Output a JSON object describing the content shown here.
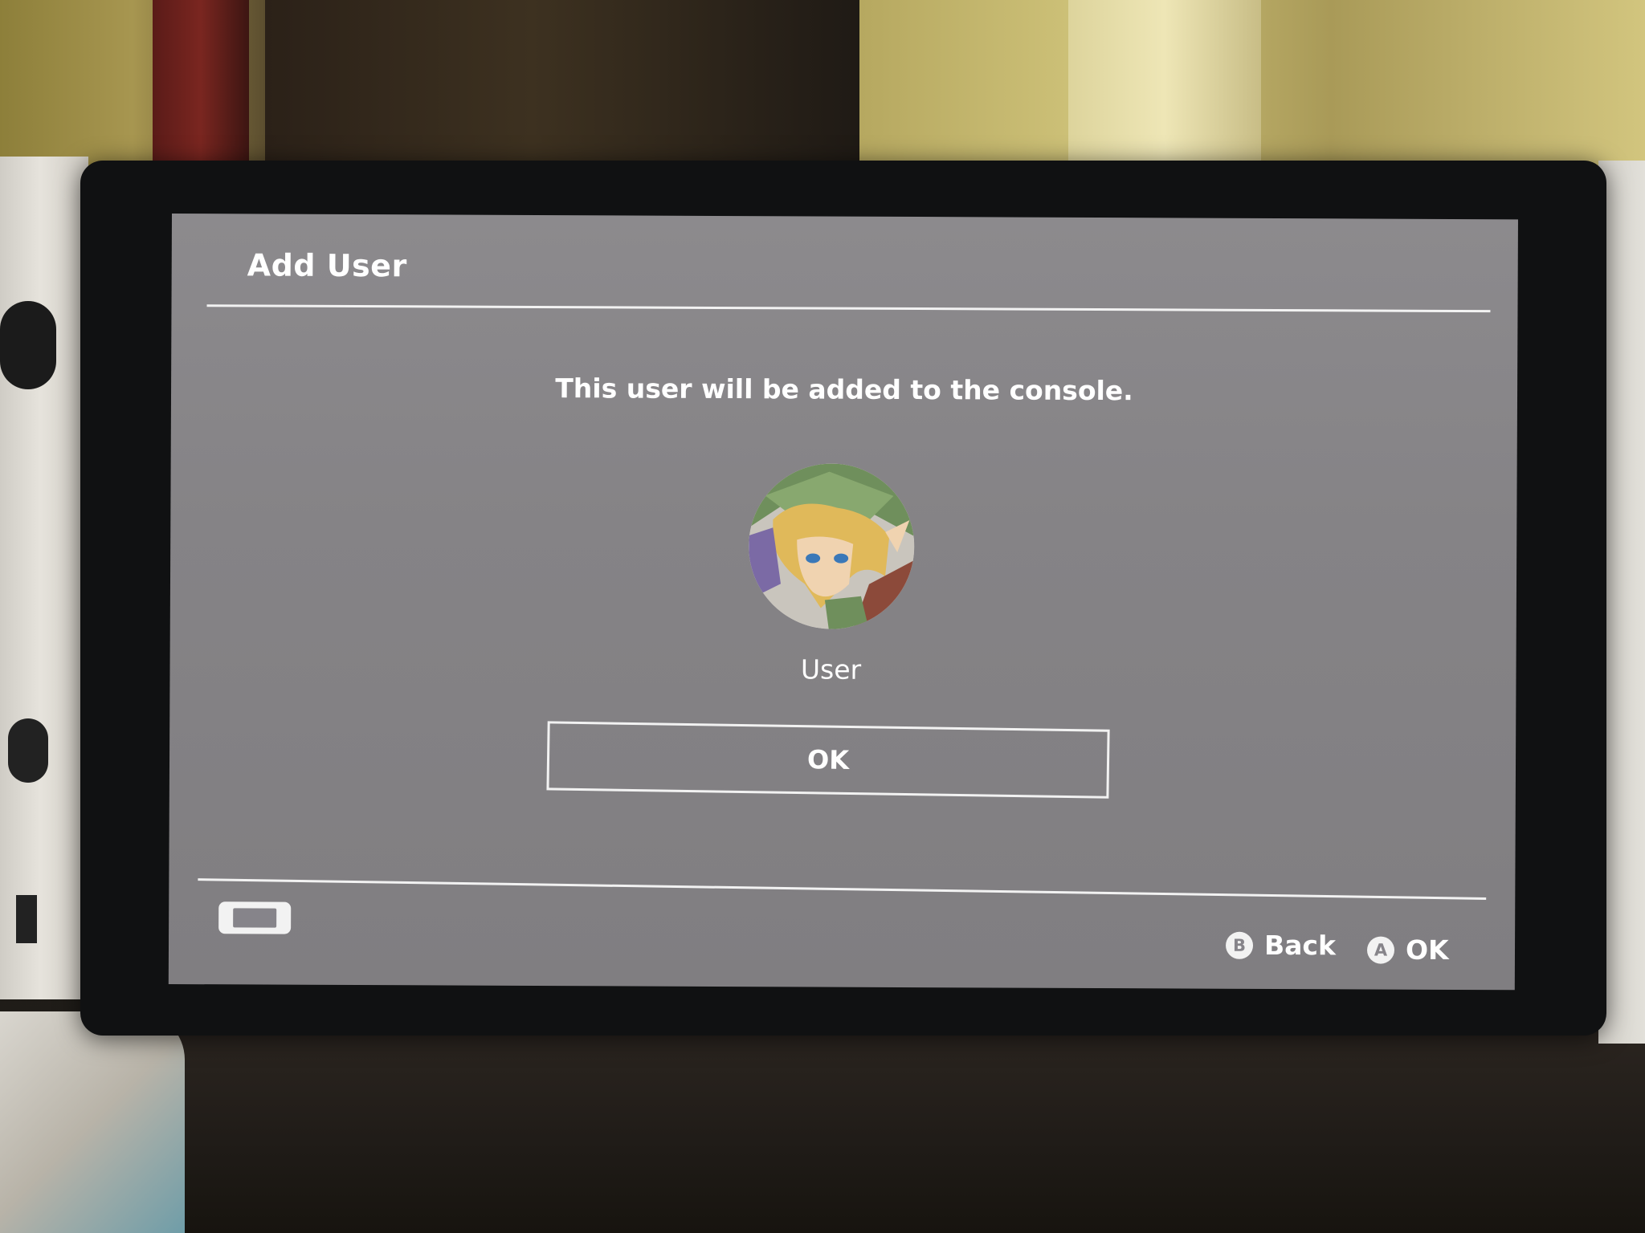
{
  "dialog": {
    "title": "Add User",
    "message": "This user will be added to the console.",
    "user_name": "User",
    "ok_button_label": "OK"
  },
  "footer": {
    "controller_icon": "handheld-console-icon",
    "hints": [
      {
        "button": "B",
        "label": "Back"
      },
      {
        "button": "A",
        "label": "OK"
      }
    ]
  },
  "colors": {
    "screen_bg": "#858386",
    "text": "#ffffff",
    "rule": "#f2f2f2"
  }
}
